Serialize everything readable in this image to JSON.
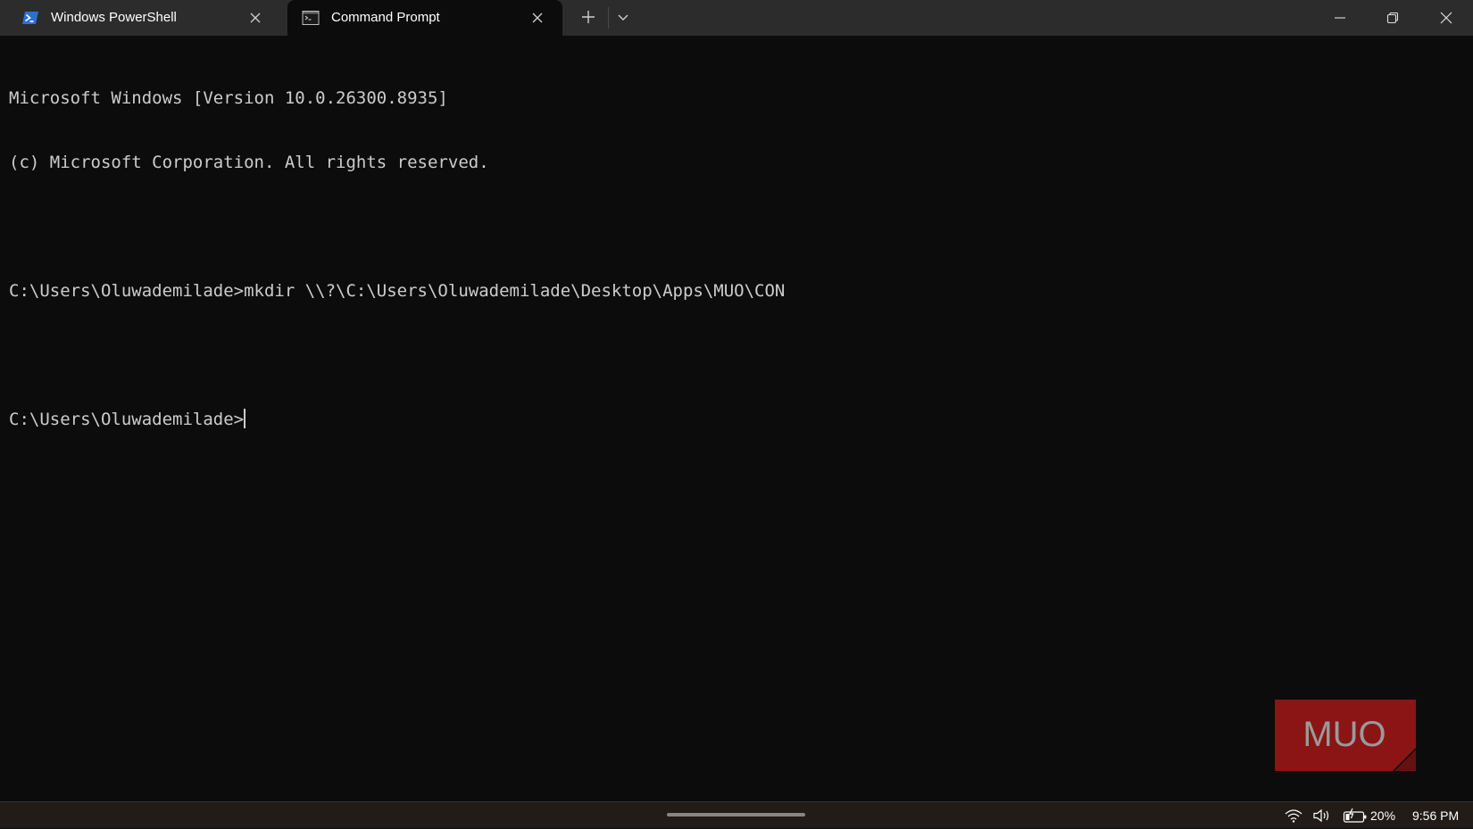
{
  "window": {
    "tabs": [
      {
        "label": "Windows PowerShell",
        "icon": "powershell-icon",
        "active": false
      },
      {
        "label": "Command Prompt",
        "icon": "cmd-icon",
        "active": true
      }
    ],
    "new_tab_icon": "plus-icon",
    "dropdown_icon": "chevron-down-icon",
    "controls": [
      "minimize-icon",
      "restore-icon",
      "close-icon"
    ]
  },
  "terminal": {
    "lines": [
      "Microsoft Windows [Version 10.0.26300.8935]",
      "(c) Microsoft Corporation. All rights reserved.",
      "",
      "C:\\Users\\Oluwademilade>mkdir \\\\?\\C:\\Users\\Oluwademilade\\Desktop\\Apps\\MUO\\CON",
      "",
      "C:\\Users\\Oluwademilade>"
    ]
  },
  "watermark": {
    "text": "MUO",
    "color": "#8b1414"
  },
  "taskbar": {
    "battery_percent": "20%",
    "time": "9:56 PM",
    "icons": [
      "wifi-icon",
      "volume-icon",
      "battery-charging-icon"
    ]
  },
  "colors": {
    "terminal_bg": "#0c0c0c",
    "titlebar_bg": "#2c2c2c",
    "text": "#cccccc",
    "powershell_blue": "#2f6fd1"
  }
}
